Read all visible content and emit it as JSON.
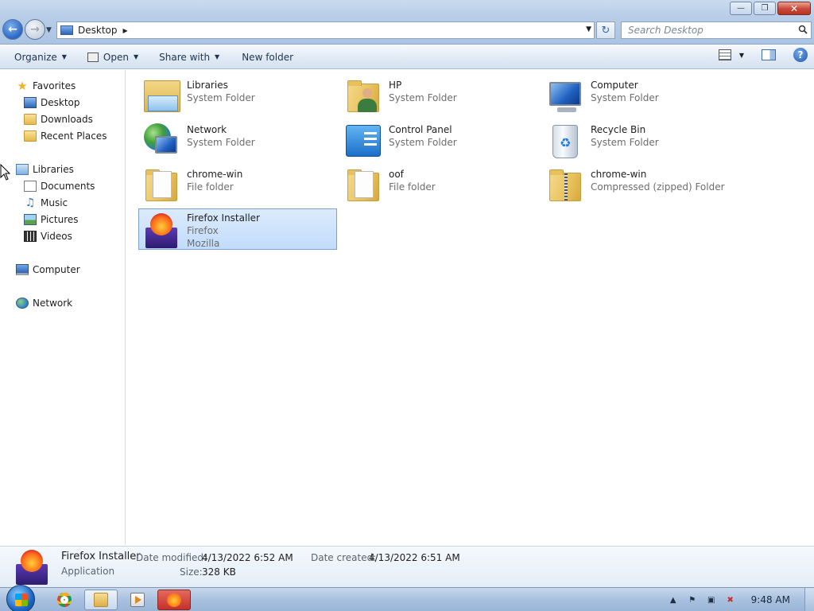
{
  "window": {
    "minimize_icon": "minimize-icon",
    "maximize_icon": "restore-icon",
    "close_icon": "close-icon"
  },
  "address": {
    "location": "Desktop",
    "search_placeholder": "Search Desktop"
  },
  "toolbar": {
    "organize": "Organize",
    "open": "Open",
    "share_with": "Share with",
    "new_folder": "New folder"
  },
  "nav": {
    "favorites": "Favorites",
    "desktop": "Desktop",
    "downloads": "Downloads",
    "recent_places": "Recent Places",
    "libraries": "Libraries",
    "documents": "Documents",
    "music": "Music",
    "pictures": "Pictures",
    "videos": "Videos",
    "computer": "Computer",
    "network": "Network"
  },
  "items": [
    {
      "name": "Libraries",
      "sub1": "System Folder"
    },
    {
      "name": "HP",
      "sub1": "System Folder"
    },
    {
      "name": "Computer",
      "sub1": "System Folder"
    },
    {
      "name": "Network",
      "sub1": "System Folder"
    },
    {
      "name": "Control Panel",
      "sub1": "System Folder"
    },
    {
      "name": "Recycle Bin",
      "sub1": "System Folder"
    },
    {
      "name": "chrome-win",
      "sub1": "File folder"
    },
    {
      "name": "oof",
      "sub1": "File folder"
    },
    {
      "name": "chrome-win",
      "sub1": "Compressed (zipped) Folder"
    },
    {
      "name": "Firefox Installer",
      "sub1": "Firefox",
      "sub2": "Mozilla"
    }
  ],
  "details": {
    "name": "Firefox Installer",
    "type": "Application",
    "modified_label": "Date modified:",
    "modified_value": "4/13/2022 6:52 AM",
    "size_label": "Size:",
    "size_value": "328 KB",
    "created_label": "Date created:",
    "created_value": "4/13/2022 6:51 AM"
  },
  "taskbar": {
    "clock": "9:48 AM"
  },
  "colors": {
    "selection": "#c1dcfb",
    "titlebar": "#b7cde7",
    "taskbar": "#a9c1df"
  }
}
